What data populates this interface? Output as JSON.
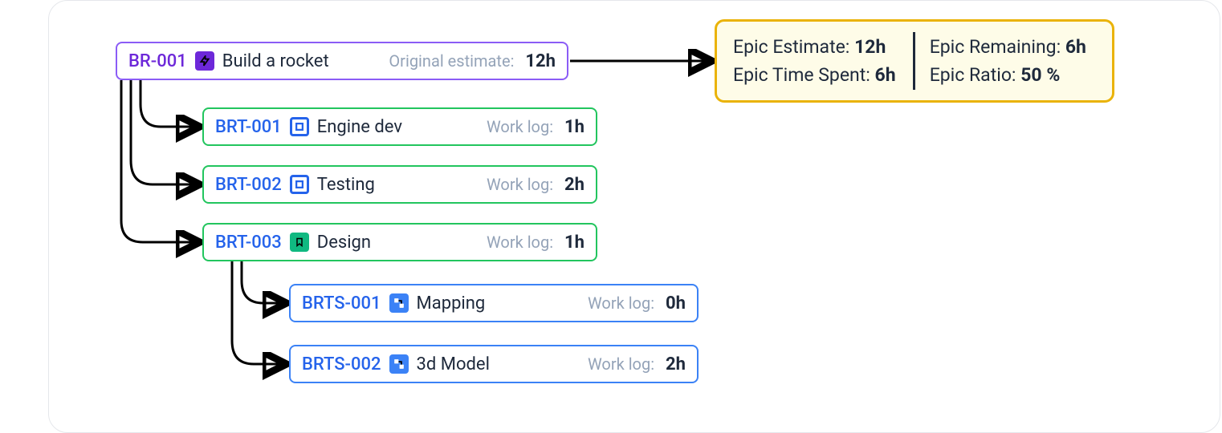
{
  "epic": {
    "id": "BR-001",
    "title": "Build a rocket",
    "estimate_label": "Original estimate:",
    "estimate_value": "12h"
  },
  "tasks": [
    {
      "id": "BRT-001",
      "title": "Engine dev",
      "log_label": "Work log:",
      "log_value": "1h",
      "icon": "task"
    },
    {
      "id": "BRT-002",
      "title": "Testing",
      "log_label": "Work log:",
      "log_value": "2h",
      "icon": "task"
    },
    {
      "id": "BRT-003",
      "title": "Design",
      "log_label": "Work log:",
      "log_value": "1h",
      "icon": "green"
    }
  ],
  "subtasks": [
    {
      "id": "BRTS-001",
      "title": "Mapping",
      "log_label": "Work log:",
      "log_value": "0h"
    },
    {
      "id": "BRTS-002",
      "title": "3d Model",
      "log_label": "Work log:",
      "log_value": "2h"
    }
  ],
  "summary": {
    "estimate_label": "Epic Estimate:",
    "estimate_value": "12h",
    "spent_label": "Epic Time Spent:",
    "spent_value": "6h",
    "remaining_label": "Epic Remaining:",
    "remaining_value": "6h",
    "ratio_label": "Epic Ratio:",
    "ratio_value": "50 %"
  }
}
